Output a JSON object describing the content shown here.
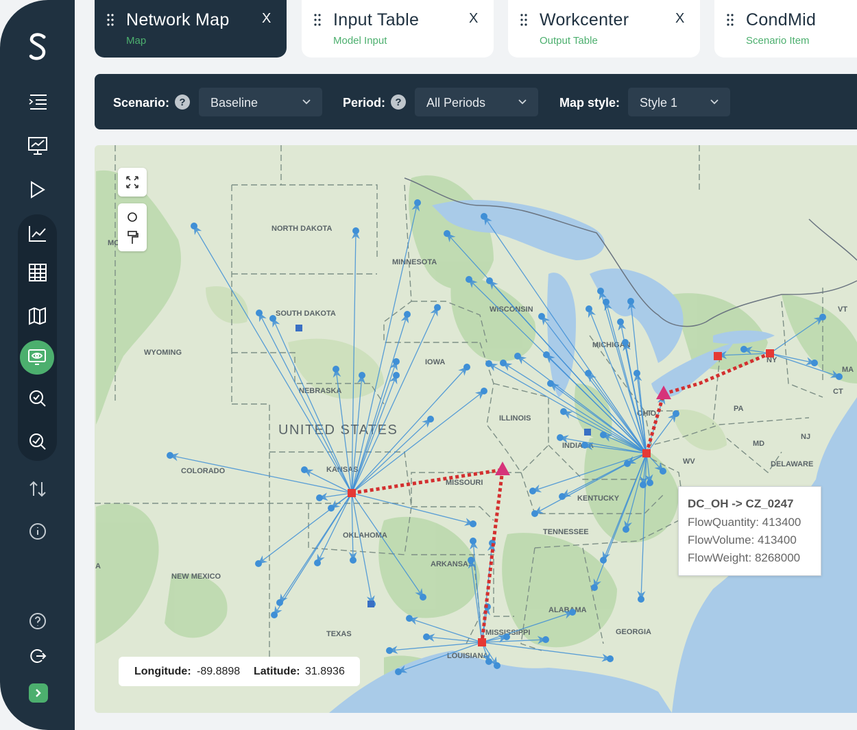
{
  "tabs": [
    {
      "title": "Network Map",
      "subtitle": "Map",
      "close": "X"
    },
    {
      "title": "Input Table",
      "subtitle": "Model Input",
      "close": "X"
    },
    {
      "title": "Workcenter",
      "subtitle": "Output Table",
      "close": "X"
    },
    {
      "title": "CondMid",
      "subtitle": "Scenario Item"
    }
  ],
  "filters": {
    "scenario_label": "Scenario:",
    "scenario_value": "Baseline",
    "period_label": "Period:",
    "period_value": "All Periods",
    "mapstyle_label": "Map style:",
    "mapstyle_value": "Style 1",
    "help_glyph": "?"
  },
  "map": {
    "labels": {
      "north_dakota": "NORTH DAKOTA",
      "minnesota": "MINNESOTA",
      "south_dakota": "SOUTH DAKOTA",
      "wyoming": "WYOMING",
      "wisconsin": "WISCONSIN",
      "michigan": "MICHIGAN",
      "iowa": "IOWA",
      "nebraska": "NEBRASKA",
      "united_states": "UNITED STATES",
      "illinois": "ILLINOIS",
      "indiana": "INDIANA",
      "ohio": "OHIO",
      "pa": "PA",
      "colorado": "COLORADO",
      "kansas": "KANSAS",
      "missouri": "MISSOURI",
      "kentucky": "KENTUCKY",
      "tennessee": "TENNESSEE",
      "oklahoma": "OKLAHOMA",
      "arkansas": "ARKANSAS",
      "new_mexico": "NEW MEXICO",
      "texas": "TEXAS",
      "alabama": "ALABAMA",
      "georgia": "GEORGIA",
      "mississippi": "MISSISSIPPI",
      "louisiana": "LOUISIANA",
      "wv": "WV",
      "md": "MD",
      "delaware": "DELAWARE",
      "nj": "NJ",
      "ny": "NY",
      "vt": "VT",
      "ma": "MA",
      "ct": "CT",
      "mo": "MO",
      "a": "A"
    },
    "tooltip": {
      "title": "DC_OH -> CZ_0247",
      "lines": [
        "FlowQuantity: 413400",
        "FlowVolume: 413400",
        "FlowWeight: 8268000"
      ]
    },
    "coords": {
      "lon_label": "Longitude:",
      "lon_value": "-89.8898",
      "lat_label": "Latitude:",
      "lat_value": "31.8936"
    }
  },
  "colors": {
    "sidebar": "#1f3140",
    "accent": "#4caf6e",
    "flow": "#3f8fd6",
    "dc": "#e53935",
    "route": "#d32f2f",
    "plant": "#d6337a"
  }
}
